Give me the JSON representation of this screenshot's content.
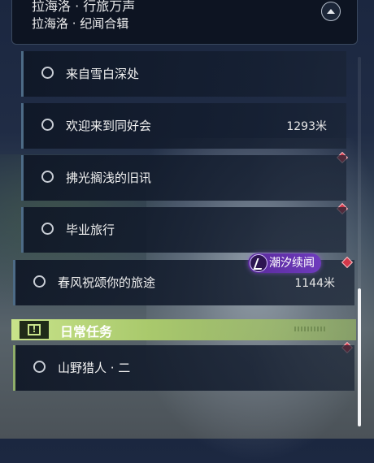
{
  "header": {
    "title_line1": "拉海洛 · 行旅万声",
    "title_line2": "拉海洛 · 纪闻合辑"
  },
  "quests": [
    {
      "name": "来自雪白深处",
      "distance": ""
    },
    {
      "name": "欢迎来到同好会",
      "distance": "1293米"
    },
    {
      "name": "拂光搁浅的旧讯",
      "distance": ""
    },
    {
      "name": "毕业旅行",
      "distance": ""
    },
    {
      "name": "春风祝颂你的旅途",
      "distance": "1144米"
    }
  ],
  "tag": {
    "label": "潮汐续闻"
  },
  "daily_section": {
    "title": "日常任务",
    "quests": [
      {
        "name": "山野猎人 · 二",
        "distance": ""
      }
    ]
  },
  "colors": {
    "accent_green": "#c8e38a",
    "marker_red": "#d4384a",
    "tag_purple": "#6e3bbd"
  }
}
